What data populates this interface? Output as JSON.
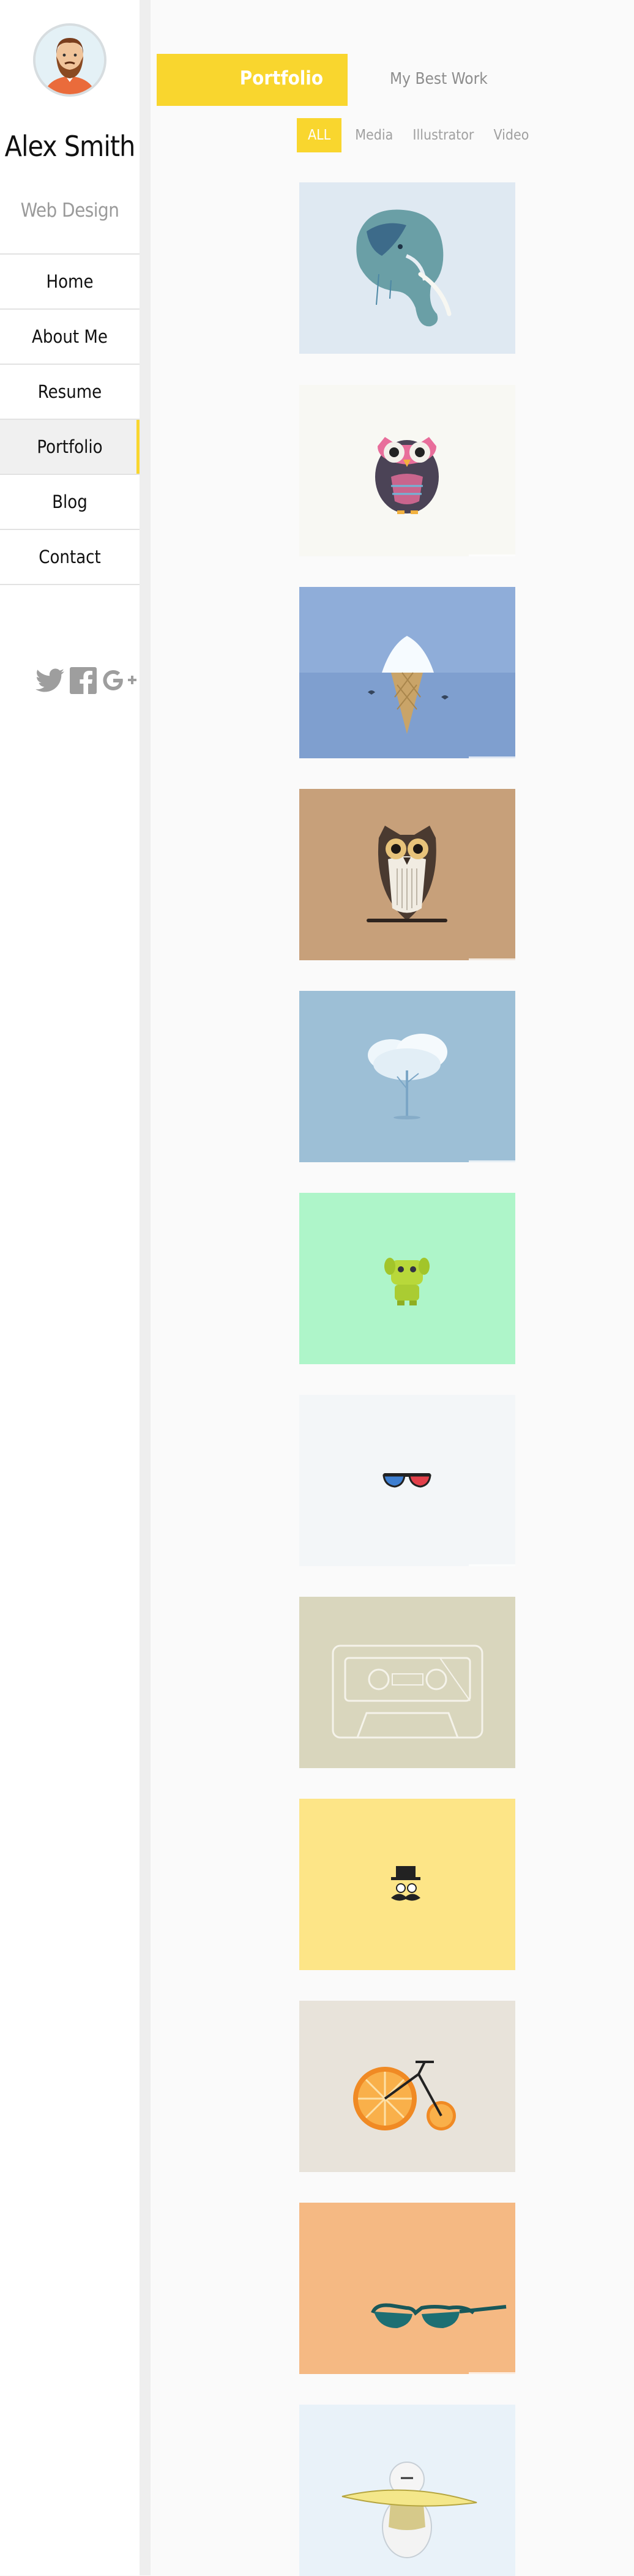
{
  "profile": {
    "name": "Alex Smith",
    "role": "Web Design"
  },
  "menu": [
    {
      "label": "Home",
      "active": false
    },
    {
      "label": "About Me",
      "active": false
    },
    {
      "label": "Resume",
      "active": false
    },
    {
      "label": "Portfolio",
      "active": true
    },
    {
      "label": "Blog",
      "active": false
    },
    {
      "label": "Contact",
      "active": false
    }
  ],
  "social": [
    "twitter-icon",
    "facebook-icon",
    "google-plus-icon"
  ],
  "header": {
    "title": "Portfolio",
    "subtitle": "My Best Work"
  },
  "filters": [
    {
      "label": "ALL",
      "active": true
    },
    {
      "label": "Media",
      "active": false
    },
    {
      "label": "Illustrator",
      "active": false
    },
    {
      "label": "Video",
      "active": false
    }
  ],
  "portfolio": [
    {
      "subject": "elephant",
      "bg": "#dfe9f2"
    },
    {
      "subject": "owl-pink",
      "bg": "#f8f8f3"
    },
    {
      "subject": "iceberg-cone",
      "bg": "#8fadd9"
    },
    {
      "subject": "owl-brown",
      "bg": "#c7a07a"
    },
    {
      "subject": "snowy-tree",
      "bg": "#9dbfd6"
    },
    {
      "subject": "green-robot",
      "bg": "#aef5c9"
    },
    {
      "subject": "3d-glasses",
      "bg": "#f3f6f8"
    },
    {
      "subject": "cassette",
      "bg": "#d9d6bd"
    },
    {
      "subject": "mustache-man",
      "bg": "#fde587"
    },
    {
      "subject": "orange-bicycle",
      "bg": "#e8e3da"
    },
    {
      "subject": "sunglasses",
      "bg": "#f5b983"
    },
    {
      "subject": "surfer",
      "bg": "#e9f2f9"
    }
  ],
  "colors": {
    "accent": "#f9d62e",
    "sidebar": "#ffffff",
    "page": "#fafafa"
  }
}
